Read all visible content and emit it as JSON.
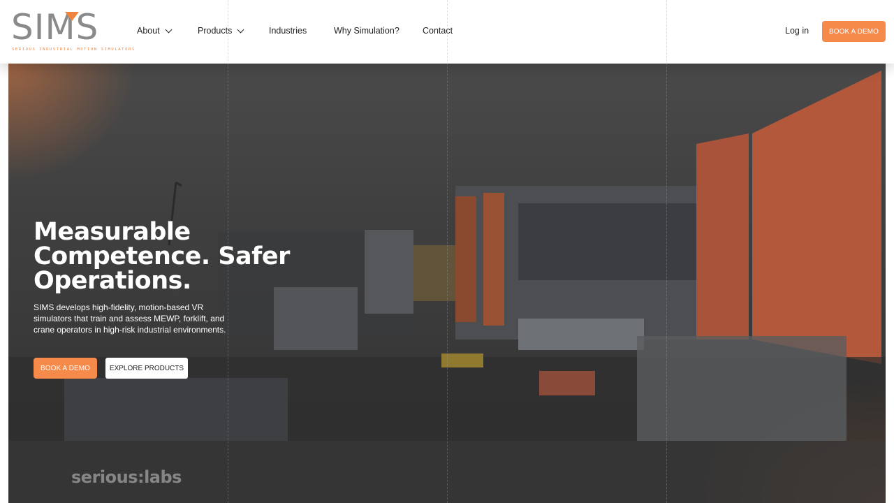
{
  "brand": {
    "logo_word": "SIMS",
    "tagline": "SERIOUS INDUSTRIAL MOTION SIMULATORS",
    "accent": "#f58a4b"
  },
  "nav": {
    "items": [
      {
        "label": "About",
        "has_dropdown": true
      },
      {
        "label": "Products",
        "has_dropdown": true
      },
      {
        "label": "Industries",
        "has_dropdown": false
      },
      {
        "label": "Why Simulation?",
        "has_dropdown": false
      },
      {
        "label": "Contact",
        "has_dropdown": false
      }
    ],
    "login": "Log in",
    "cta": "BOOK A DEMO"
  },
  "hero": {
    "title_line1": "Measurable",
    "title_line2": "Competence. Safer",
    "title_line3": "Operations.",
    "subtitle": "SIMS develops high-fidelity, motion-based VR simulators that train and assess MEWP, forklift, and crane operators in high-risk industrial environments.",
    "primary_cta": "BOOK A DEMO",
    "secondary_cta": "EXPLORE PRODUCTS",
    "watermark": "serious:labs"
  }
}
